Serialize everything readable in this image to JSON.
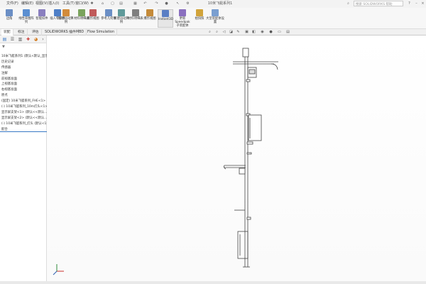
{
  "titlebar": {
    "menus": [
      "文件(F)",
      "编辑(E)",
      "视图(V)",
      "插入(I)",
      "工具(T)",
      "窗口(W)"
    ],
    "document_title": "10米飞艇系列1",
    "search_placeholder": "搜索 SOLIDWORKS 帮助"
  },
  "ribbon": {
    "buttons": [
      {
        "label": "边角",
        "color": "#6b8fc5"
      },
      {
        "label": "线性草图阵列",
        "color": "#5b8fd1"
      },
      {
        "label": "智能扣件",
        "color": "#8a7fbf"
      },
      {
        "label": "插入零部件",
        "color": "#4e7fc7"
      },
      {
        "label": "新建运动算例",
        "color": "#d28b3a"
      },
      {
        "label": "材料明细表",
        "color": "#7aa35c"
      },
      {
        "label": "爆炸视图",
        "color": "#c05a5a"
      },
      {
        "label": "参考几何体",
        "color": "#6b8fc5"
      },
      {
        "label": "新建运动算例",
        "color": "#5f9a9a"
      },
      {
        "label": "材料明细表",
        "color": "#7f7f7f"
      },
      {
        "label": "爆炸视图",
        "color": "#c58b3a"
      },
      {
        "label": "Instant3D",
        "color": "#5a7ec4"
      },
      {
        "label": "更新 Speedpak 子装配体",
        "color": "#8a6fbf"
      },
      {
        "label": "拍快照",
        "color": "#d1a33a"
      },
      {
        "label": "大型装配体设置",
        "color": "#7a9fd0"
      }
    ]
  },
  "tabs": {
    "items": [
      "装配",
      "标注",
      "评估",
      "SOLIDWORKS 插件",
      "MBD",
      "Flow Simulation"
    ],
    "active_index": 0
  },
  "left_panel": {
    "filter_icon": "filter-icon",
    "tree": [
      "10米飞艇系列1 (默认<默认_显示状态",
      "历史记录",
      "传感器",
      "注解",
      "前视基准面",
      "上视基准面",
      "右视基准面",
      "原点",
      "(固定) 10米飞艇系列_FHE<1> ...",
      "(-) 10米飞艇系列_10m灯头<1> ...",
      "显示屏支架<1> (默认<<默认...",
      "显示屏支架<2> (默认<<默认...",
      "(-) 10米飞艇系列_灯头 (默认<1>...",
      "配合"
    ],
    "selected_index": 13
  },
  "viewport": {
    "triad_label": "x y z"
  }
}
